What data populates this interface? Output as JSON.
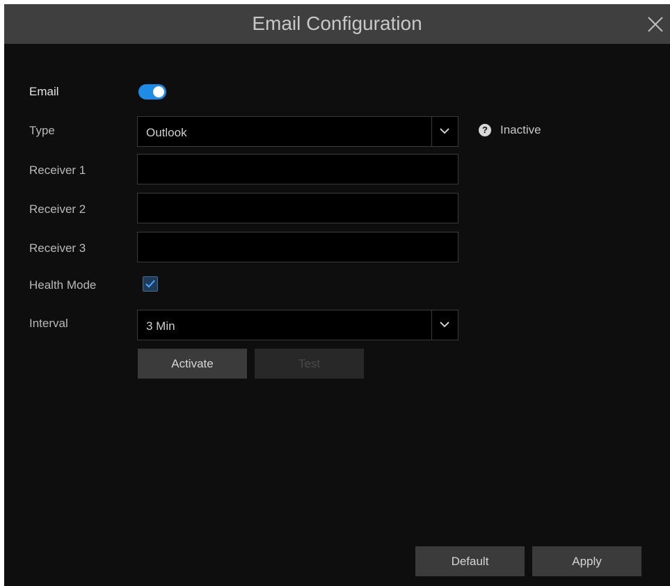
{
  "dialog": {
    "title": "Email Configuration"
  },
  "colors": {
    "accent": "#1e8ce6",
    "background": "#0e0e0e",
    "titlebar": "#3f3f3f"
  },
  "icons": {
    "close": "close-icon",
    "dropdown": "chevron-down-icon",
    "help": "question-icon",
    "check": "checkmark-icon"
  },
  "form": {
    "email": {
      "label": "Email",
      "enabled": true
    },
    "type": {
      "label": "Type",
      "value": "Outlook",
      "status": "Inactive"
    },
    "receiver1": {
      "label": "Receiver 1",
      "value": ""
    },
    "receiver2": {
      "label": "Receiver 2",
      "value": ""
    },
    "receiver3": {
      "label": "Receiver 3",
      "value": ""
    },
    "health_mode": {
      "label": "Health Mode",
      "checked": true
    },
    "interval": {
      "label": "Interval",
      "value": "3 Min"
    }
  },
  "actions": {
    "activate": "Activate",
    "test": "Test"
  },
  "footer": {
    "default": "Default",
    "apply": "Apply"
  }
}
